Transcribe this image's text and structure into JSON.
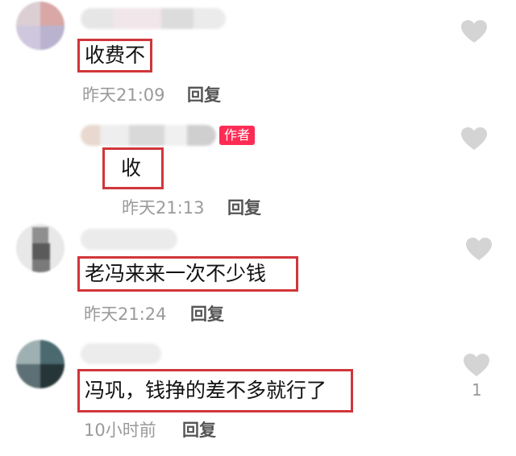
{
  "comments": [
    {
      "text": "收费不",
      "time": "昨天21:09",
      "reply_label": "回复"
    },
    {
      "text": "收",
      "time": "昨天21:13",
      "reply_label": "回复",
      "author_tag": "作者"
    },
    {
      "text": "老冯来来一次不少钱",
      "time": "昨天21:24",
      "reply_label": "回复"
    },
    {
      "text": "冯巩，钱挣的差不多就行了",
      "time": "10小时前",
      "reply_label": "回复",
      "like_count": "1"
    }
  ],
  "colors": {
    "highlight_border": "#d0363a",
    "author_tag": "#fe2c55",
    "heart": "#d4d4d4"
  },
  "icons": {
    "like": "heart-icon"
  }
}
